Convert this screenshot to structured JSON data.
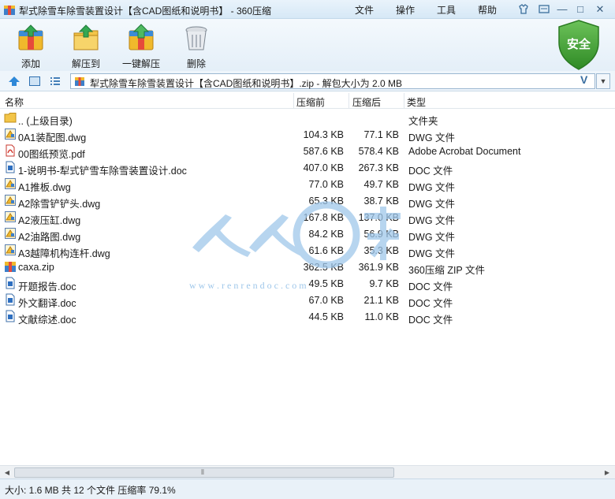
{
  "window": {
    "title": "犁式除雪车除雪装置设计【含CAD图纸和说明书】 - 360压缩",
    "menu": [
      "文件",
      "操作",
      "工具",
      "帮助"
    ],
    "controls": {
      "skin": "skin-icon",
      "minimize": "—",
      "maximize": "□",
      "close": "✕"
    }
  },
  "toolbar": {
    "buttons": [
      {
        "label": "添加",
        "icon": "add-archive-icon"
      },
      {
        "label": "解压到",
        "icon": "extract-to-icon"
      },
      {
        "label": "一键解压",
        "icon": "one-click-extract-icon"
      },
      {
        "label": "删除",
        "icon": "delete-icon"
      }
    ],
    "security_badge": "安全"
  },
  "address": {
    "path": "犁式除雪车除雪装置设计【含CAD图纸和说明书】.zip - 解包大小为 2.0 MB",
    "v_mark": "V"
  },
  "columns": {
    "name": "名称",
    "before": "压缩前",
    "after": "压缩后",
    "type": "类型"
  },
  "files": [
    {
      "name": ".. (上级目录)",
      "before": "",
      "after": "",
      "type": "文件夹",
      "icon": "folder"
    },
    {
      "name": "0A1装配图.dwg",
      "before": "104.3 KB",
      "after": "77.1 KB",
      "type": "DWG 文件",
      "icon": "dwg"
    },
    {
      "name": "00图纸预览.pdf",
      "before": "587.6 KB",
      "after": "578.4 KB",
      "type": "Adobe Acrobat Document",
      "icon": "pdf"
    },
    {
      "name": "1-说明书-犁式铲雪车除雪装置设计.doc",
      "before": "407.0 KB",
      "after": "267.3 KB",
      "type": "DOC 文件",
      "icon": "doc"
    },
    {
      "name": "A1推板.dwg",
      "before": "77.0 KB",
      "after": "49.7 KB",
      "type": "DWG 文件",
      "icon": "dwg"
    },
    {
      "name": "A2除雪铲铲头.dwg",
      "before": "65.3 KB",
      "after": "38.7 KB",
      "type": "DWG 文件",
      "icon": "dwg"
    },
    {
      "name": "A2液压缸.dwg",
      "before": "167.8 KB",
      "after": "137.0 KB",
      "type": "DWG 文件",
      "icon": "dwg"
    },
    {
      "name": "A2油路图.dwg",
      "before": "84.2 KB",
      "after": "56.9 KB",
      "type": "DWG 文件",
      "icon": "dwg"
    },
    {
      "name": "A3越障机构连杆.dwg",
      "before": "61.6 KB",
      "after": "35.3 KB",
      "type": "DWG 文件",
      "icon": "dwg"
    },
    {
      "name": "caxa.zip",
      "before": "362.5 KB",
      "after": "361.9 KB",
      "type": "360压缩 ZIP 文件",
      "icon": "zip"
    },
    {
      "name": "开题报告.doc",
      "before": "49.5 KB",
      "after": "9.7 KB",
      "type": "DOC 文件",
      "icon": "doc"
    },
    {
      "name": "外文翻译.doc",
      "before": "67.0 KB",
      "after": "21.1 KB",
      "type": "DOC 文件",
      "icon": "doc"
    },
    {
      "name": "文献综述.doc",
      "before": "44.5 KB",
      "after": "11.0 KB",
      "type": "DOC 文件",
      "icon": "doc"
    }
  ],
  "watermark": {
    "text": "人人文库",
    "url": "w w w . r e n r e n d o c . c o m"
  },
  "status": "大小: 1.6 MB 共 12 个文件 压缩率 79.1%",
  "colors": {
    "accent": "#2a7fd0",
    "shield": "#3a9b2e",
    "titlebar": "#d6e8f6"
  }
}
